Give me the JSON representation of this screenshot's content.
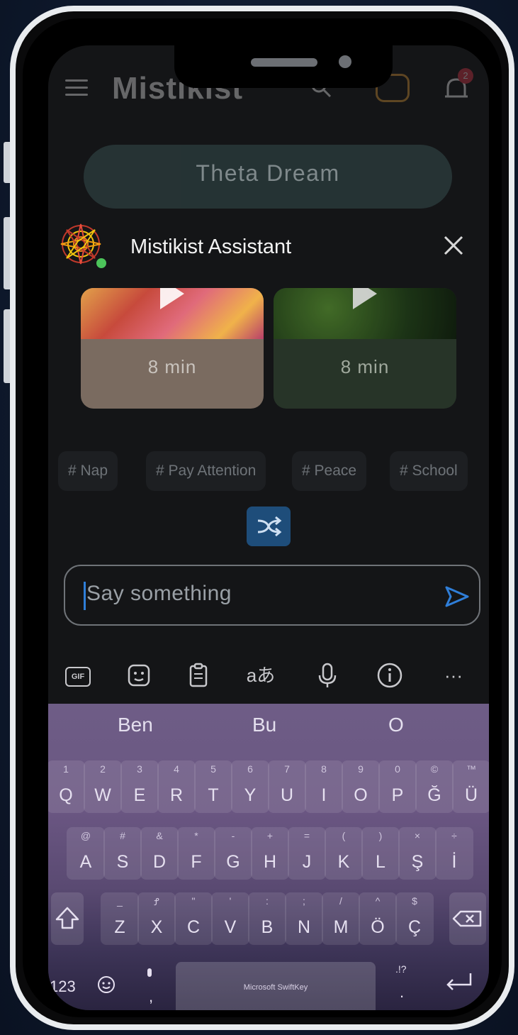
{
  "app": {
    "title": "Mistikist",
    "notification_count": "2"
  },
  "banner": {
    "label": "Theta Dream"
  },
  "assistant": {
    "name": "Mistikist Assistant",
    "cards": [
      {
        "duration": "8 min"
      },
      {
        "duration": "8 min"
      }
    ],
    "tags": [
      "# Nap",
      "# Pay Attention",
      "# Peace",
      "# School"
    ],
    "input_placeholder": "Say something"
  },
  "keyboard": {
    "toolbar": [
      "gif-icon",
      "sticker-icon",
      "clipboard-icon",
      "translate-icon",
      "microphone-icon",
      "info-icon",
      "more-icon"
    ],
    "translate_glyph": "aあ",
    "gif_label": "GIF",
    "more_label": "···",
    "suggestions": [
      "Ben",
      "Bu",
      "O"
    ],
    "row1": [
      {
        "sub": "1",
        "main": "Q"
      },
      {
        "sub": "2",
        "main": "W"
      },
      {
        "sub": "3",
        "main": "E"
      },
      {
        "sub": "4",
        "main": "R"
      },
      {
        "sub": "5",
        "main": "T"
      },
      {
        "sub": "6",
        "main": "Y"
      },
      {
        "sub": "7",
        "main": "U"
      },
      {
        "sub": "8",
        "main": "I"
      },
      {
        "sub": "9",
        "main": "O"
      },
      {
        "sub": "0",
        "main": "P"
      },
      {
        "sub": "©",
        "main": "Ğ"
      },
      {
        "sub": "™",
        "main": "Ü"
      }
    ],
    "row2": [
      {
        "sub": "@",
        "main": "A"
      },
      {
        "sub": "#",
        "main": "S"
      },
      {
        "sub": "&",
        "main": "D"
      },
      {
        "sub": "*",
        "main": "F"
      },
      {
        "sub": "-",
        "main": "G"
      },
      {
        "sub": "+",
        "main": "H"
      },
      {
        "sub": "=",
        "main": "J"
      },
      {
        "sub": "(",
        "main": "K"
      },
      {
        "sub": ")",
        "main": "L"
      },
      {
        "sub": "×",
        "main": "Ş"
      },
      {
        "sub": "÷",
        "main": "İ"
      }
    ],
    "row3": [
      {
        "sub": "_",
        "main": "Z"
      },
      {
        "sub": "Ꝭ",
        "main": "X"
      },
      {
        "sub": "\"",
        "main": "C"
      },
      {
        "sub": "'",
        "main": "V"
      },
      {
        "sub": ":",
        "main": "B"
      },
      {
        "sub": ";",
        "main": "N"
      },
      {
        "sub": "/",
        "main": "M"
      },
      {
        "sub": "^",
        "main": "Ö"
      },
      {
        "sub": "$",
        "main": "Ç"
      }
    ],
    "numbers_key": "123",
    "comma": ",",
    "period": ".",
    "punct_hint": ".!?",
    "space_label": "Microsoft SwiftKey"
  }
}
